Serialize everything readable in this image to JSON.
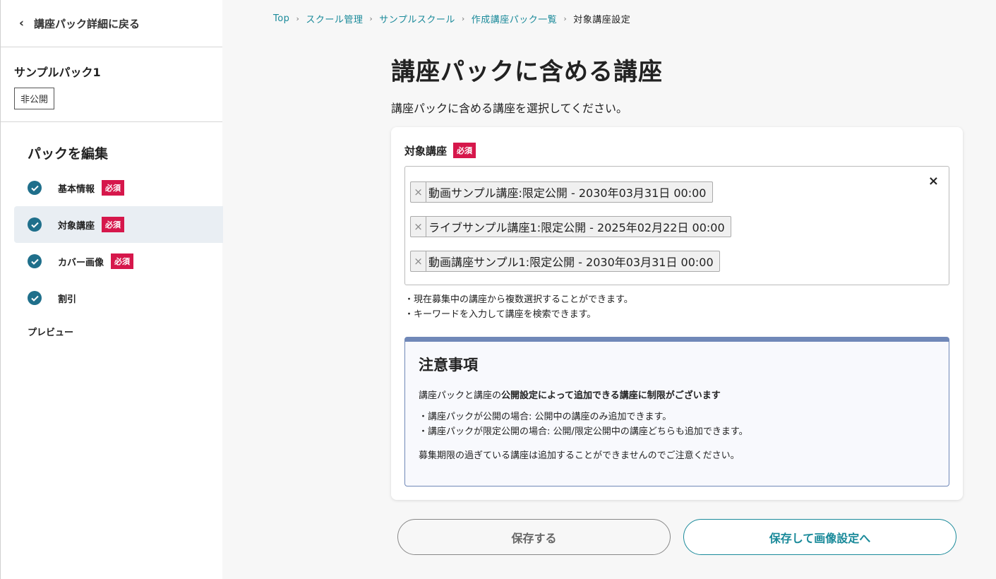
{
  "sidebar": {
    "back_label": "講座パック詳細に戻る",
    "pack_name": "サンプルパック1",
    "pack_status": "非公開",
    "edit_heading": "パックを編集",
    "items": [
      {
        "label": "基本情報",
        "badge": "必須"
      },
      {
        "label": "対象講座",
        "badge": "必須"
      },
      {
        "label": "カバー画像",
        "badge": "必須"
      },
      {
        "label": "割引"
      }
    ],
    "preview_label": "プレビュー"
  },
  "breadcrumb": {
    "items": [
      "Top",
      "スクール管理",
      "サンプルスクール",
      "作成講座パック一覧",
      "対象講座設定"
    ],
    "separator": "›"
  },
  "main": {
    "title": "講座パックに含める講座",
    "description": "講座パックに含める講座を選択してください。"
  },
  "form": {
    "field_label": "対象講座",
    "required_badge": "必須",
    "clear_icon": "×",
    "chip_remove": "×",
    "selected": [
      "動画サンプル講座:限定公開 - 2030年03月31日 00:00",
      "ライブサンプル講座1:限定公開 - 2025年02月22日 00:00",
      "動画講座サンプル1:限定公開 - 2030年03月31日 00:00"
    ],
    "hints": [
      "・現在募集中の講座から複数選択することができます。",
      "・キーワードを入力して講座を検索できます。"
    ]
  },
  "notice": {
    "title": "注意事項",
    "lead_prefix": "講座パックと講座の",
    "lead_bold": "公開設定によって追加できる講座に制限がございます",
    "rules": [
      "・講座パックが公開の場合: 公開中の講座のみ追加できます。",
      "・講座パックが限定公開の場合: 公開/限定公開中の講座どちらも追加できます。"
    ],
    "footer": "募集期限の過ぎている講座は追加することができませんのでご注意ください。"
  },
  "actions": {
    "save_label": "保存する",
    "save_next_label": "保存して画像設定へ"
  },
  "colors": {
    "accent": "#1a8a9a",
    "check": "#1f6f8b",
    "badge": "#d6174b",
    "notice_border": "#7088b8"
  }
}
